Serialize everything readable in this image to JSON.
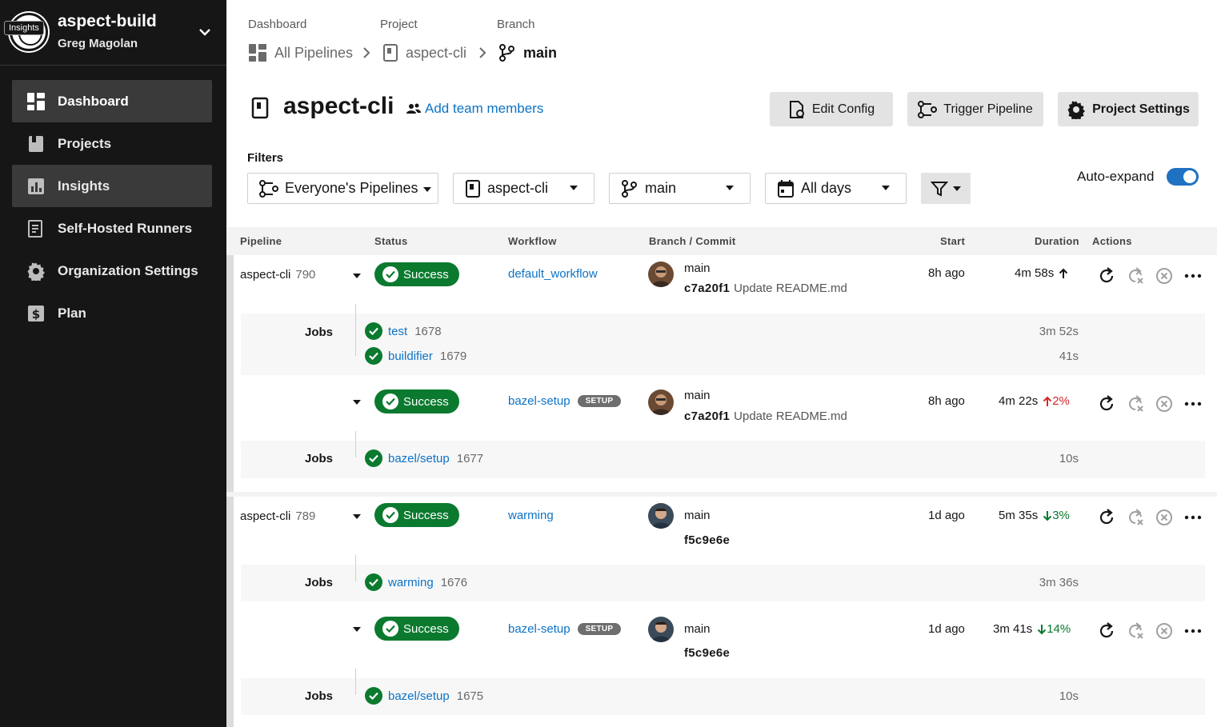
{
  "sidebar": {
    "org_name": "aspect-build",
    "user_name": "Greg Magolan",
    "tooltip": "Insights",
    "items": [
      {
        "label": "Dashboard",
        "icon": "dashboard-icon",
        "active": true
      },
      {
        "label": "Projects",
        "icon": "projects-icon"
      },
      {
        "label": "Insights",
        "icon": "insights-icon",
        "hover": true
      },
      {
        "label": "Self-Hosted Runners",
        "icon": "runners-icon"
      },
      {
        "label": "Organization Settings",
        "icon": "gear-icon"
      },
      {
        "label": "Plan",
        "icon": "dollar-icon"
      }
    ]
  },
  "breadcrumb": {
    "labels": [
      "Dashboard",
      "Project",
      "Branch"
    ],
    "items": [
      "All Pipelines",
      "aspect-cli",
      "main"
    ]
  },
  "header": {
    "project_title": "aspect-cli",
    "add_team": "Add team members",
    "buttons": {
      "edit_config": "Edit Config",
      "trigger": "Trigger Pipeline",
      "settings": "Project Settings"
    }
  },
  "filters": {
    "label": "Filters",
    "pipelines": "Everyone's Pipelines",
    "project": "aspect-cli",
    "branch": "main",
    "days": "All days",
    "auto_expand": "Auto-expand",
    "auto_expand_on": true
  },
  "table": {
    "headers": [
      "Pipeline",
      "Status",
      "Workflow",
      "Branch / Commit",
      "Start",
      "Duration",
      "Actions"
    ],
    "jobs_label": "Jobs",
    "groups": [
      {
        "pipeline": "aspect-cli",
        "number": "790",
        "workflows": [
          {
            "status": "Success",
            "name": "default_workflow",
            "setup": "",
            "branch": "main",
            "sha": "c7a20f1",
            "message": "Update README.md",
            "start": "8h ago",
            "duration": "4m 58s",
            "trend": "up-arrow",
            "pct": "",
            "jobs": [
              {
                "name": "test",
                "number": "1678",
                "duration": "3m 52s"
              },
              {
                "name": "buildifier",
                "number": "1679",
                "duration": "41s"
              }
            ]
          },
          {
            "status": "Success",
            "name": "bazel-setup",
            "setup": "SETUP",
            "branch": "main",
            "sha": "c7a20f1",
            "message": "Update README.md",
            "start": "8h ago",
            "duration": "4m 22s",
            "trend": "up",
            "pct": "2%",
            "jobs": [
              {
                "name": "bazel/setup",
                "number": "1677",
                "duration": "10s"
              }
            ]
          }
        ]
      },
      {
        "pipeline": "aspect-cli",
        "number": "789",
        "workflows": [
          {
            "status": "Success",
            "name": "warming",
            "setup": "",
            "branch": "main",
            "sha": "f5c9e6e",
            "message": "",
            "start": "1d ago",
            "duration": "5m 35s",
            "trend": "down",
            "pct": "3%",
            "jobs": [
              {
                "name": "warming",
                "number": "1676",
                "duration": "3m 36s"
              }
            ]
          },
          {
            "status": "Success",
            "name": "bazel-setup",
            "setup": "SETUP",
            "branch": "main",
            "sha": "f5c9e6e",
            "message": "",
            "start": "1d ago",
            "duration": "3m 41s",
            "trend": "down",
            "pct": "14%",
            "jobs": [
              {
                "name": "bazel/setup",
                "number": "1675",
                "duration": "10s"
              }
            ]
          }
        ]
      }
    ]
  },
  "colors": {
    "success": "#0b7a2f",
    "link": "#0c73c6",
    "sidebar_bg": "#161616",
    "toggle": "#1f71c1",
    "regress": "#d02a2a"
  }
}
